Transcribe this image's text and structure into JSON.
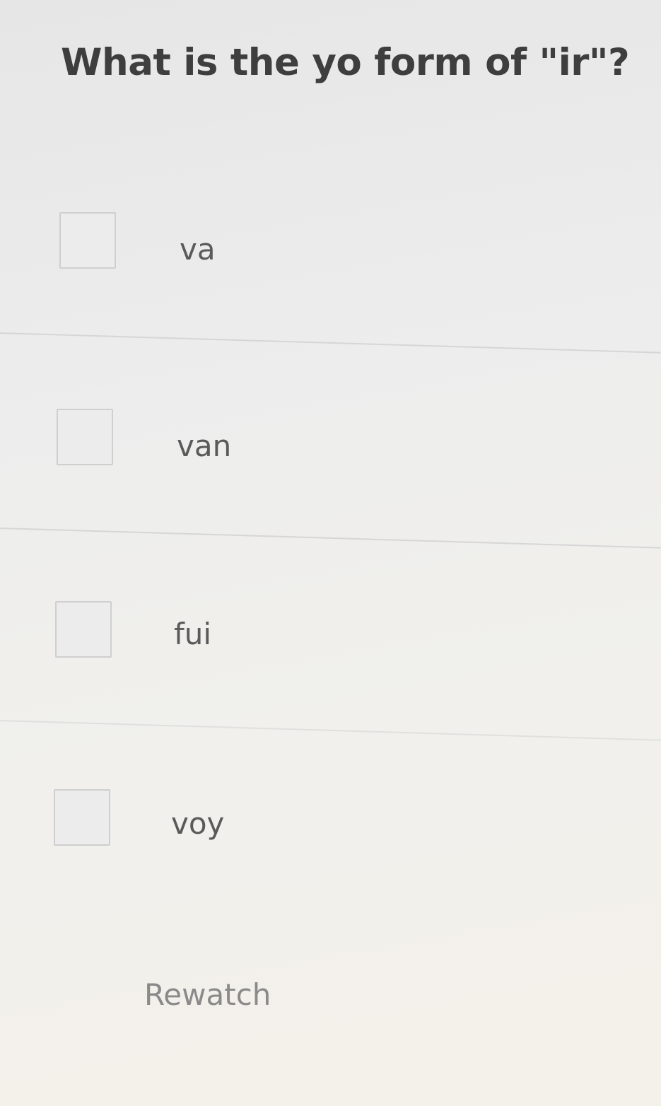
{
  "question": {
    "text": "What is the yo form of \"ir\"?"
  },
  "options": [
    {
      "label": "va",
      "checked": false
    },
    {
      "label": "van",
      "checked": false
    },
    {
      "label": "fui",
      "checked": false
    },
    {
      "label": "voy",
      "checked": false
    }
  ],
  "actions": {
    "rewatch_label": "Rewatch"
  },
  "colors": {
    "question_text": "#3e3e3e",
    "option_text": "#5a5a5a",
    "checkbox_border": "#cfcfcf",
    "divider": "#d6d6d6",
    "rewatch_text": "#8a8a8a"
  }
}
